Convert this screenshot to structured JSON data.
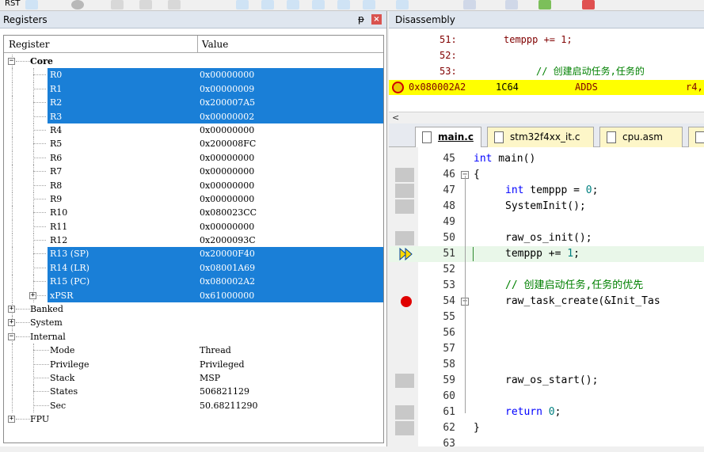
{
  "toolbar": {
    "rst_label": "RST"
  },
  "registers": {
    "title": "Registers",
    "columns": [
      "Register",
      "Value"
    ],
    "rows": [
      {
        "name": "Core",
        "value": "",
        "level": 0,
        "expander": "−",
        "bold": true,
        "selected": false
      },
      {
        "name": "R0",
        "value": "0x00000000",
        "level": 2,
        "selected": true
      },
      {
        "name": "R1",
        "value": "0x00000009",
        "level": 2,
        "selected": true
      },
      {
        "name": "R2",
        "value": "0x200007A5",
        "level": 2,
        "selected": true
      },
      {
        "name": "R3",
        "value": "0x00000002",
        "level": 2,
        "selected": true
      },
      {
        "name": "R4",
        "value": "0x00000000",
        "level": 2,
        "selected": false
      },
      {
        "name": "R5",
        "value": "0x200008FC",
        "level": 2,
        "selected": false
      },
      {
        "name": "R6",
        "value": "0x00000000",
        "level": 2,
        "selected": false
      },
      {
        "name": "R7",
        "value": "0x00000000",
        "level": 2,
        "selected": false
      },
      {
        "name": "R8",
        "value": "0x00000000",
        "level": 2,
        "selected": false
      },
      {
        "name": "R9",
        "value": "0x00000000",
        "level": 2,
        "selected": false
      },
      {
        "name": "R10",
        "value": "0x080023CC",
        "level": 2,
        "selected": false
      },
      {
        "name": "R11",
        "value": "0x00000000",
        "level": 2,
        "selected": false
      },
      {
        "name": "R12",
        "value": "0x2000093C",
        "level": 2,
        "selected": false
      },
      {
        "name": "R13 (SP)",
        "value": "0x20000F40",
        "level": 2,
        "selected": true
      },
      {
        "name": "R14 (LR)",
        "value": "0x08001A69",
        "level": 2,
        "selected": true
      },
      {
        "name": "R15 (PC)",
        "value": "0x080002A2",
        "level": 2,
        "selected": true
      },
      {
        "name": "xPSR",
        "value": "0x61000000",
        "level": 2,
        "expander": "+",
        "selected": true
      },
      {
        "name": "Banked",
        "value": "",
        "level": 0,
        "expander": "+",
        "selected": false
      },
      {
        "name": "System",
        "value": "",
        "level": 0,
        "expander": "+",
        "selected": false
      },
      {
        "name": "Internal",
        "value": "",
        "level": 0,
        "expander": "−",
        "selected": false
      },
      {
        "name": "Mode",
        "value": "Thread",
        "level": 1,
        "selected": false
      },
      {
        "name": "Privilege",
        "value": "Privileged",
        "level": 1,
        "selected": false
      },
      {
        "name": "Stack",
        "value": "MSP",
        "level": 1,
        "selected": false
      },
      {
        "name": "States",
        "value": "506821129",
        "level": 1,
        "selected": false
      },
      {
        "name": "Sec",
        "value": "50.68211290",
        "level": 1,
        "selected": false
      },
      {
        "name": "FPU",
        "value": "",
        "level": 0,
        "expander": "+",
        "selected": false
      }
    ]
  },
  "disassembly": {
    "title": "Disassembly",
    "lines": [
      {
        "num": "51:",
        "code": "temppp  += 1;"
      },
      {
        "num": "52:",
        "code": ""
      },
      {
        "num": "53:",
        "comment": "// 创建启动任务,任务的"
      }
    ],
    "current": {
      "addr": "0x080002A2",
      "opcode": "1C64",
      "mnemonic": "ADDS",
      "args": "r4,"
    }
  },
  "tabs": [
    "main.c",
    "stm32f4xx_it.c",
    "cpu.asm"
  ],
  "editor": {
    "lines": [
      {
        "n": "45",
        "text": "int main()"
      },
      {
        "n": "46",
        "text": "{"
      },
      {
        "n": "47",
        "text": "int temppp = 0;"
      },
      {
        "n": "48",
        "text": "SystemInit();"
      },
      {
        "n": "49",
        "text": ""
      },
      {
        "n": "50",
        "text": "raw_os_init();"
      },
      {
        "n": "51",
        "text": "temppp  += 1;"
      },
      {
        "n": "52",
        "text": ""
      },
      {
        "n": "53",
        "text": "// 创建启动任务,任务的优先"
      },
      {
        "n": "54",
        "text": "raw_task_create(&Init_Tas"
      },
      {
        "n": "55",
        "text": ""
      },
      {
        "n": "56",
        "text": ""
      },
      {
        "n": "57",
        "text": ""
      },
      {
        "n": "58",
        "text": ""
      },
      {
        "n": "59",
        "text": "raw_os_start();"
      },
      {
        "n": "60",
        "text": ""
      },
      {
        "n": "61",
        "text": "return 0;"
      },
      {
        "n": "62",
        "text": "}"
      },
      {
        "n": "63",
        "text": ""
      }
    ]
  },
  "colors": {
    "selection": "#1a7fd7",
    "current_line": "#ffff00",
    "keyword": "#0000ff",
    "comment": "#008000"
  }
}
